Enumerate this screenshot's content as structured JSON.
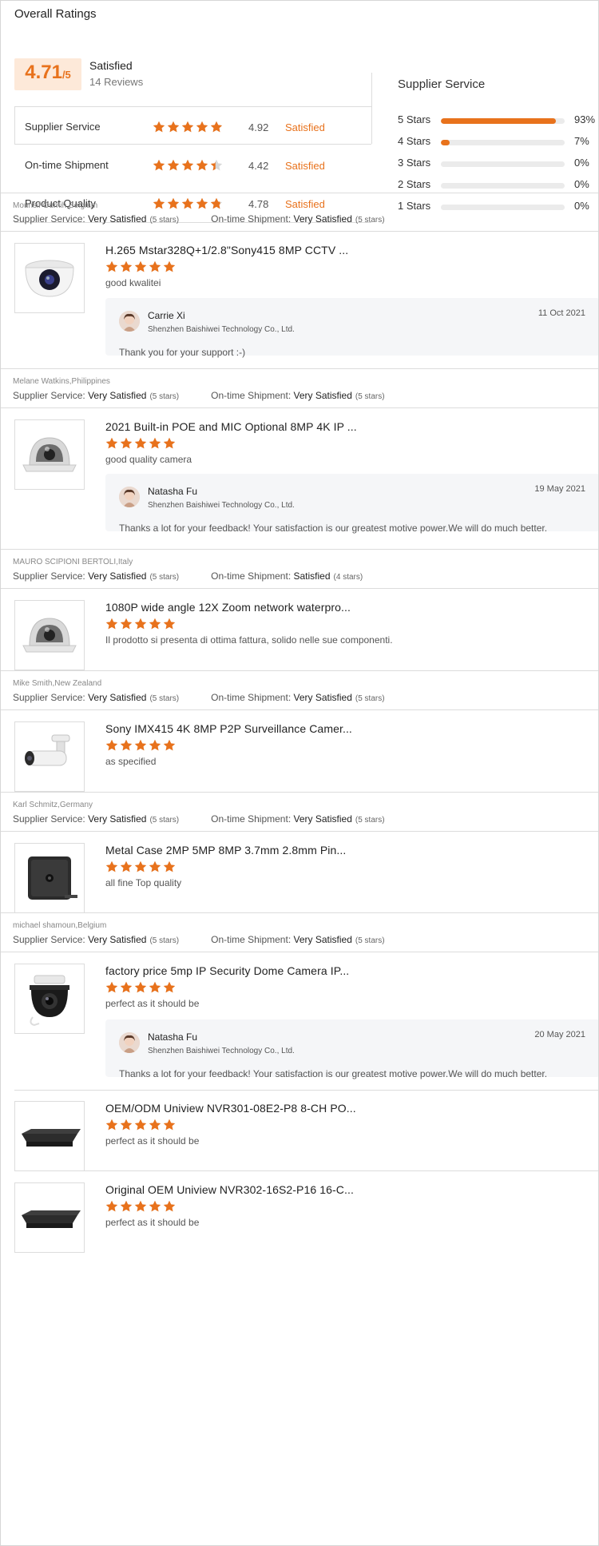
{
  "title": "Overall Ratings",
  "summary": {
    "score": "4.71",
    "score_suffix": "/5",
    "label": "Satisfied",
    "reviews": "14 Reviews",
    "rows": [
      {
        "name": "Supplier Service",
        "value": "4.92",
        "status": "Satisfied",
        "rating": 4.92
      },
      {
        "name": "On-time Shipment",
        "value": "4.42",
        "status": "Satisfied",
        "rating": 4.42
      },
      {
        "name": "Product Quality",
        "value": "4.78",
        "status": "Satisfied",
        "rating": 4.78
      }
    ]
  },
  "supplier_service": {
    "title": "Supplier Service",
    "bars": [
      {
        "label": "5 Stars",
        "pct": "93%",
        "value": 93
      },
      {
        "label": "4 Stars",
        "pct": "7%",
        "value": 7
      },
      {
        "label": "3 Stars",
        "pct": "0%",
        "value": 0
      },
      {
        "label": "2 Stars",
        "pct": "0%",
        "value": 0
      },
      {
        "label": "1 Stars",
        "pct": "0%",
        "value": 0
      }
    ]
  },
  "labels": {
    "supplier_service": "Supplier Service:",
    "ontime_shipment": "On-time Shipment:"
  },
  "colors": {
    "accent": "#e8721c",
    "star_empty": "#d8d8d8"
  },
  "reviews": [
    {
      "reviewer": "Mounsif Oumih,Belgium",
      "supplier_rating": "Very Satisfied",
      "supplier_stars": "(5 stars)",
      "shipment_rating": "Very Satisfied",
      "shipment_stars": "(5 stars)",
      "products": [
        {
          "name": "H.265 Mstar328Q+1/2.8\"Sony415 8MP CCTV ...",
          "rating": 5,
          "comment": "good kwalitei",
          "image": "dome-camera-icon",
          "reply": {
            "name": "Carrie Xi",
            "company": "Shenzhen Baishiwei Technology Co., Ltd.",
            "date": "11 Oct 2021",
            "text": "Thank you for your support :-)"
          }
        }
      ]
    },
    {
      "reviewer": "Melane Watkins,Philippines",
      "supplier_rating": "Very Satisfied",
      "supplier_stars": "(5 stars)",
      "shipment_rating": "Very Satisfied",
      "shipment_stars": "(5 stars)",
      "products": [
        {
          "name": "2021 Built-in POE and MIC Optional 8MP 4K IP ...",
          "rating": 5,
          "comment": "good quality camera",
          "image": "vandal-dome-camera-icon",
          "reply": {
            "name": "Natasha Fu",
            "company": "Shenzhen Baishiwei Technology Co., Ltd.",
            "date": "19 May 2021",
            "text": "Thanks a lot for your feedback!  Your satisfaction is our greatest motive power.We will do much better."
          }
        }
      ]
    },
    {
      "reviewer": "MAURO SCIPIONI BERTOLI,Italy",
      "supplier_rating": "Very Satisfied",
      "supplier_stars": "(5 stars)",
      "shipment_rating": "Satisfied",
      "shipment_stars": "(4 stars)",
      "products": [
        {
          "name": "1080P wide angle 12X Zoom network waterpro...",
          "rating": 5,
          "comment": "Il prodotto si presenta di ottima fattura, solido nelle sue componenti.",
          "image": "vandal-dome-camera-icon"
        }
      ]
    },
    {
      "reviewer": "Mike Smith,New Zealand",
      "supplier_rating": "Very Satisfied",
      "supplier_stars": "(5 stars)",
      "shipment_rating": "Very Satisfied",
      "shipment_stars": "(5 stars)",
      "products": [
        {
          "name": "Sony IMX415 4K 8MP P2P Surveillance Camer...",
          "rating": 5,
          "comment": "as specified",
          "image": "bullet-camera-icon"
        }
      ]
    },
    {
      "reviewer": "Karl Schmitz,Germany",
      "supplier_rating": "Very Satisfied",
      "supplier_stars": "(5 stars)",
      "shipment_rating": "Very Satisfied",
      "shipment_stars": "(5 stars)",
      "products": [
        {
          "name": "Metal Case 2MP 5MP 8MP 3.7mm 2.8mm Pin...",
          "rating": 5,
          "comment": "all fine Top quality",
          "image": "pinhole-camera-icon"
        }
      ]
    },
    {
      "reviewer": "michael shamoun,Belgium",
      "supplier_rating": "Very Satisfied",
      "supplier_stars": "(5 stars)",
      "shipment_rating": "Very Satisfied",
      "shipment_stars": "(5 stars)",
      "products": [
        {
          "name": "factory price 5mp IP Security Dome Camera IP...",
          "rating": 5,
          "comment": "perfect as it should be",
          "image": "black-dome-camera-icon",
          "reply": {
            "name": "Natasha Fu",
            "company": "Shenzhen Baishiwei Technology Co., Ltd.",
            "date": "20 May 2021",
            "text": "Thanks a lot for your feedback!  Your satisfaction is our greatest motive power.We will do much better."
          }
        },
        {
          "name": "OEM/ODM Uniview NVR301-08E2-P8 8-CH PO...",
          "rating": 5,
          "comment": "perfect as it should be",
          "image": "nvr-icon"
        },
        {
          "name": "Original OEM Uniview NVR302-16S2-P16 16-C...",
          "rating": 5,
          "comment": "perfect as it should be",
          "image": "nvr-icon"
        }
      ]
    }
  ]
}
